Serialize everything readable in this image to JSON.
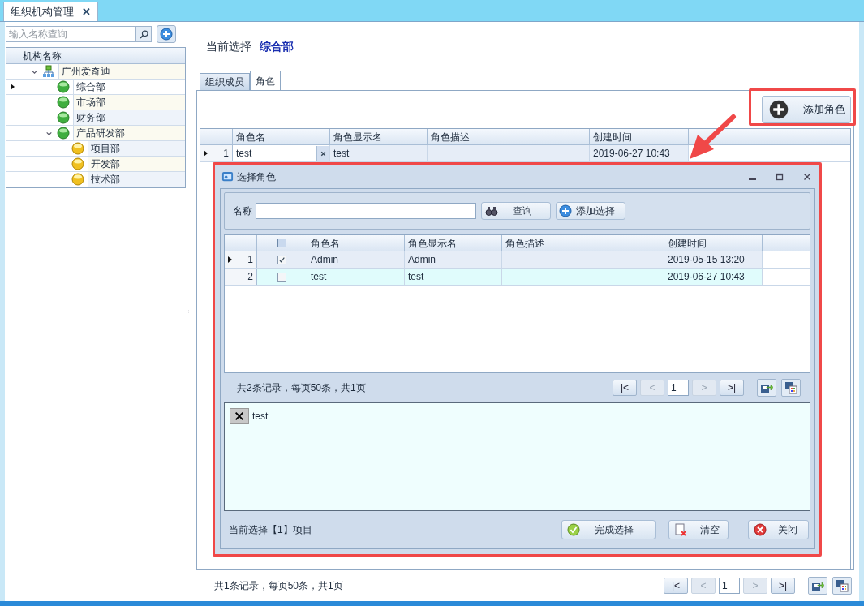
{
  "doc_tab": {
    "label": "组织机构管理",
    "close": "✕"
  },
  "tree": {
    "search_placeholder": "输入名称查询",
    "column": "机构名称",
    "nodes": [
      {
        "label": "广州爱奇迪",
        "kind": "org",
        "selected": false,
        "expanded": true,
        "children": [
          {
            "label": "综合部",
            "kind": "green",
            "selected": true
          },
          {
            "label": "市场部",
            "kind": "green",
            "selected": false
          },
          {
            "label": "财务部",
            "kind": "green",
            "selected": false
          },
          {
            "label": "产品研发部",
            "kind": "green",
            "selected": false,
            "expanded": true,
            "children": [
              {
                "label": "项目部",
                "kind": "yellow",
                "selected": false
              },
              {
                "label": "开发部",
                "kind": "yellow",
                "selected": false
              },
              {
                "label": "技术部",
                "kind": "yellow",
                "selected": false
              }
            ]
          }
        ]
      }
    ]
  },
  "current": {
    "label": "当前选择",
    "value": "综合部"
  },
  "tabs": [
    {
      "label": "组织成员",
      "selected": false
    },
    {
      "label": "角色",
      "selected": true
    }
  ],
  "add_button": "添加角色",
  "grid": {
    "columns": [
      "角色名",
      "角色显示名",
      "角色描述",
      "创建时间"
    ],
    "rows": [
      {
        "index": "1",
        "selected": true,
        "cells": [
          "test",
          "test",
          "",
          "2019-06-27 10:43"
        ]
      }
    ]
  },
  "pager": {
    "summary": "共1条记录，每页50条，共1页",
    "page": "1",
    "buttons": [
      {
        "label": "|<",
        "disabled": false
      },
      {
        "label": "<",
        "disabled": true
      },
      {
        "label": ">",
        "disabled": true
      },
      {
        "label": ">|",
        "disabled": false
      }
    ]
  },
  "dialog": {
    "title": "选择角色",
    "name_label": "名称",
    "search_button": "查询",
    "add_button": "添加选择",
    "grid": {
      "select_all_checked": false,
      "columns": [
        "角色名",
        "角色显示名",
        "角色描述",
        "创建时间"
      ],
      "rows": [
        {
          "index": "1",
          "selected": true,
          "checked": true,
          "cells": [
            "Admin",
            "Admin",
            "",
            "2019-05-15 13:20"
          ]
        },
        {
          "index": "2",
          "selected": false,
          "checked": false,
          "cells": [
            "test",
            "test",
            "",
            "2019-06-27 10:43"
          ]
        }
      ]
    },
    "pager": {
      "summary": "共2条记录，每页50条，共1页",
      "page": "1",
      "buttons": [
        {
          "label": "|<",
          "disabled": false
        },
        {
          "label": "<",
          "disabled": true
        },
        {
          "label": ">",
          "disabled": true
        },
        {
          "label": ">|",
          "disabled": false
        }
      ]
    },
    "chips": [
      {
        "label": "test"
      }
    ],
    "status": "当前选择【1】项目",
    "buttons": [
      {
        "label": "完成选择",
        "kind": "done"
      },
      {
        "label": "清空",
        "kind": "clear"
      },
      {
        "label": "关闭",
        "kind": "close"
      }
    ]
  }
}
